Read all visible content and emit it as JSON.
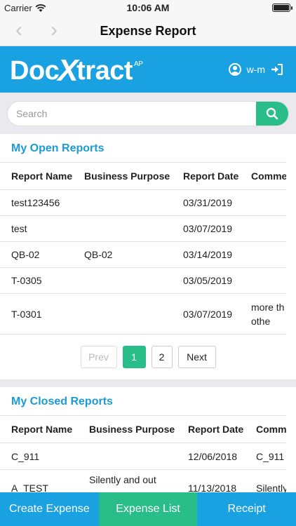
{
  "status": {
    "carrier": "Carrier",
    "time": "10:06 AM"
  },
  "nav": {
    "title": "Expense Report"
  },
  "brand": {
    "logo_main": "Doc",
    "logo_x": "X",
    "logo_rest": "tract",
    "logo_sup": "AP",
    "user": "w-m"
  },
  "search": {
    "placeholder": "Search"
  },
  "open_reports": {
    "title": "My Open Reports",
    "headers": [
      "Report Name",
      "Business Purpose",
      "Report Date",
      "Comme"
    ],
    "rows": [
      [
        "test123456",
        "",
        "03/31/2019",
        ""
      ],
      [
        "test",
        "",
        "03/07/2019",
        ""
      ],
      [
        "QB-02",
        "QB-02",
        "03/14/2019",
        ""
      ],
      [
        "T-0305",
        "",
        "03/05/2019",
        ""
      ],
      [
        "T-0301",
        "",
        "03/07/2019",
        "more th the othe"
      ]
    ],
    "pager": {
      "prev": "Prev",
      "pages": [
        "1",
        "2"
      ],
      "next": "Next"
    }
  },
  "closed_reports": {
    "title": "My Closed Reports",
    "headers": [
      "Report Name",
      "Business Purpose",
      "Report Date",
      "Comm"
    ],
    "rows": [
      [
        "C_911",
        "",
        "12/06/2018",
        "C_911"
      ],
      [
        "A_TEST",
        "Silently and out",
        "11/13/2018",
        "Silently"
      ]
    ]
  },
  "tabs": [
    "Create Expense",
    "Expense List",
    "Receipt"
  ],
  "colors": {
    "brand_blue": "#1aa1e2",
    "accent_green": "#29bd8a",
    "title_blue": "#1a9bd8"
  }
}
